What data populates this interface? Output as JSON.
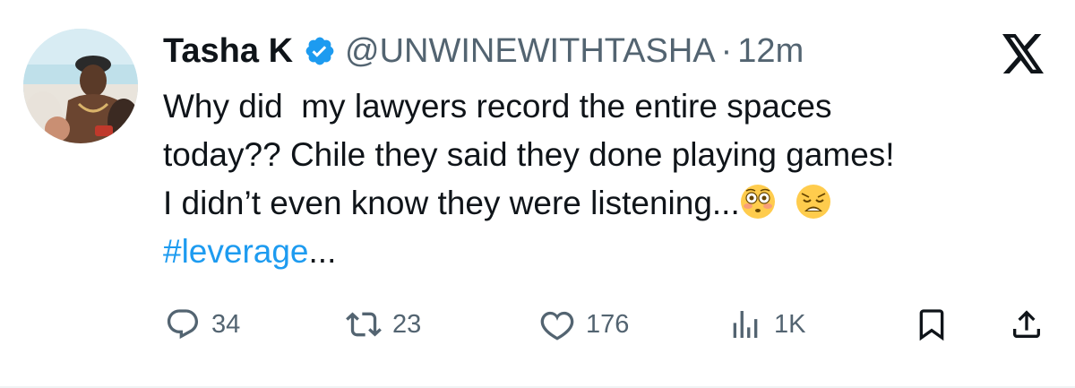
{
  "tweet": {
    "display_name": "Tasha K",
    "handle": "@UNWINEWITHTASHA",
    "separator": "·",
    "time": "12m",
    "text_lines": [
      "Why did  my lawyers record the entire spaces",
      "today?? Chile they said they done playing games!",
      "I didn’t even know they were listening..."
    ],
    "hashtag": "#leverage",
    "ellipsis": "...",
    "emojis": [
      "flushed-face",
      "weary-face"
    ]
  },
  "actions": {
    "replies": "34",
    "retweets": "23",
    "likes": "176",
    "views": "1K"
  },
  "colors": {
    "text": "#0f1419",
    "muted": "#536471",
    "accent": "#1d9bf0",
    "verified": "#1d9bf0"
  },
  "icons": {
    "brand": "x-logo-icon",
    "verified": "verified-badge-icon",
    "reply": "reply-icon",
    "retweet": "retweet-icon",
    "like": "heart-icon",
    "views": "views-icon",
    "bookmark": "bookmark-icon",
    "share": "share-icon"
  }
}
